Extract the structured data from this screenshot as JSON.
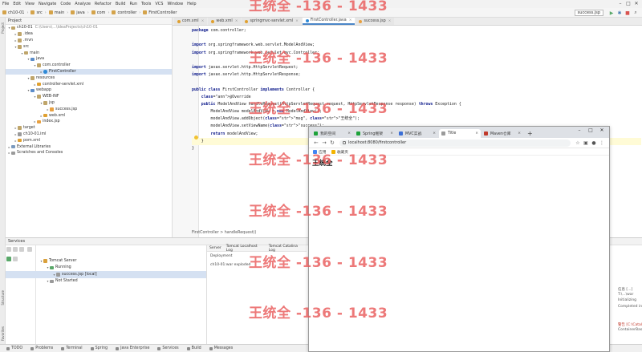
{
  "ide": {
    "menu": [
      "File",
      "Edit",
      "View",
      "Navigate",
      "Code",
      "Analyze",
      "Refactor",
      "Build",
      "Run",
      "Tools",
      "VCS",
      "Window",
      "Help"
    ],
    "breadcrumb": [
      "ch10-01",
      "src",
      "main",
      "java",
      "com",
      "controller",
      "FirstController"
    ],
    "run_config": "success.jsp",
    "project_panel_title": "Project",
    "project_tree": [
      {
        "label": "ch10-01",
        "hint": "C:\\Users\\...\\IdeaProjects\\ch10-01",
        "level": 0,
        "icon": "folder",
        "open": true
      },
      {
        "label": ".idea",
        "level": 1,
        "icon": "folder"
      },
      {
        "label": ".mvn",
        "level": 1,
        "icon": "folder"
      },
      {
        "label": "src",
        "level": 1,
        "icon": "folder",
        "open": true
      },
      {
        "label": "main",
        "level": 2,
        "icon": "folder",
        "open": true
      },
      {
        "label": "java",
        "level": 3,
        "icon": "bluefolder",
        "open": true
      },
      {
        "label": "com.controller",
        "level": 4,
        "icon": "folder",
        "open": true
      },
      {
        "label": "FirstController",
        "level": 5,
        "icon": "java",
        "selected": true
      },
      {
        "label": "resources",
        "level": 3,
        "icon": "folder",
        "open": true
      },
      {
        "label": "controller-servlet.xml",
        "level": 4,
        "icon": "xml"
      },
      {
        "label": "webapp",
        "level": 3,
        "icon": "bluefolder",
        "open": true
      },
      {
        "label": "WEB-INF",
        "level": 4,
        "icon": "folder",
        "open": true
      },
      {
        "label": "jsp",
        "level": 5,
        "icon": "folder",
        "open": true
      },
      {
        "label": "success.jsp",
        "level": 6,
        "icon": "jsp"
      },
      {
        "label": "web.xml",
        "level": 5,
        "icon": "xml"
      },
      {
        "label": "index.jsp",
        "level": 4,
        "icon": "jsp"
      },
      {
        "label": "target",
        "level": 1,
        "icon": "folder"
      },
      {
        "label": "ch10-01.iml",
        "level": 1,
        "icon": "file"
      },
      {
        "label": "pom.xml",
        "level": 1,
        "icon": "xml"
      },
      {
        "label": "External Libraries",
        "level": 0,
        "icon": "lib"
      },
      {
        "label": "Scratches and Consoles",
        "level": 0,
        "icon": "file"
      }
    ],
    "editor_tabs": [
      {
        "label": "com.xml",
        "color": "#e0a030"
      },
      {
        "label": "web.xml",
        "color": "#e0a030"
      },
      {
        "label": "springmvc-servlet.xml",
        "color": "#e0a030"
      },
      {
        "label": "FirstController.java",
        "color": "#2f8ad6",
        "active": true
      },
      {
        "label": "success.jsp",
        "color": "#e8a040"
      }
    ],
    "code_lines": [
      "package com.controller;",
      "",
      "import org.springframework.web.servlet.ModelAndView;",
      "import org.springframework.web.servlet.mvc.Controller;",
      "",
      "import javax.servlet.http.HttpServletRequest;",
      "import javax.servlet.http.HttpServletResponse;",
      "",
      "public class FirstController implements Controller {",
      "    @Override",
      "    public ModelAndView handleRequest(HttpServletRequest request, HttpServletResponse response) throws Exception {",
      "        ModelAndView modelAndView = new ModelAndView();",
      "        modelAndView.addObject(\"msg\", \"王统全\");",
      "        modelAndView.setViewName(\"success\");",
      "        return modelAndView;",
      "    }",
      "}"
    ],
    "editor_breadcrumb": "FirstController  >  handleRequest()",
    "services": {
      "panel_title": "Services",
      "tree": [
        {
          "label": "Tomcat Server",
          "level": 0
        },
        {
          "label": "Running",
          "level": 1
        },
        {
          "label": "success.jsp [local]",
          "level": 2,
          "selected": true
        },
        {
          "label": "Not Started",
          "level": 1
        }
      ],
      "tabs": [
        "Server",
        "Tomcat Localhost Log",
        "Tomcat Catalina Log"
      ],
      "deployment_header": "Deployment",
      "deployment_item": "ch10-01:war exploded",
      "log_lines": [
        "信息 [...]",
        "T:\\...\\war",
        "Initializing",
        "Completed initi",
        "警告 [C:\\Catalina\\",
        "ContainerBase"
      ]
    },
    "statusbar": [
      "TODO",
      "Problems",
      "Terminal",
      "Spring",
      "Java Enterprise",
      "Services",
      "Build",
      "Messages"
    ]
  },
  "browser": {
    "tabs": [
      {
        "label": "我的空间",
        "color": "#1da23a"
      },
      {
        "label": "Spring框架",
        "color": "#1da23a"
      },
      {
        "label": "MVC实战",
        "color": "#3b6fd6"
      },
      {
        "label": "Title",
        "color": "#9a9a9a",
        "active": true
      },
      {
        "label": "Maven仓库",
        "color": "#c0392b"
      }
    ],
    "url": "localhost:8080/firstcontroller",
    "bookmarks": [
      {
        "label": "应用",
        "color": "#4285f4"
      },
      {
        "label": "收藏夹",
        "color": "#f4b400"
      }
    ],
    "page_heading": "王统全"
  },
  "watermark_text": "王统全 -136 - 1433"
}
